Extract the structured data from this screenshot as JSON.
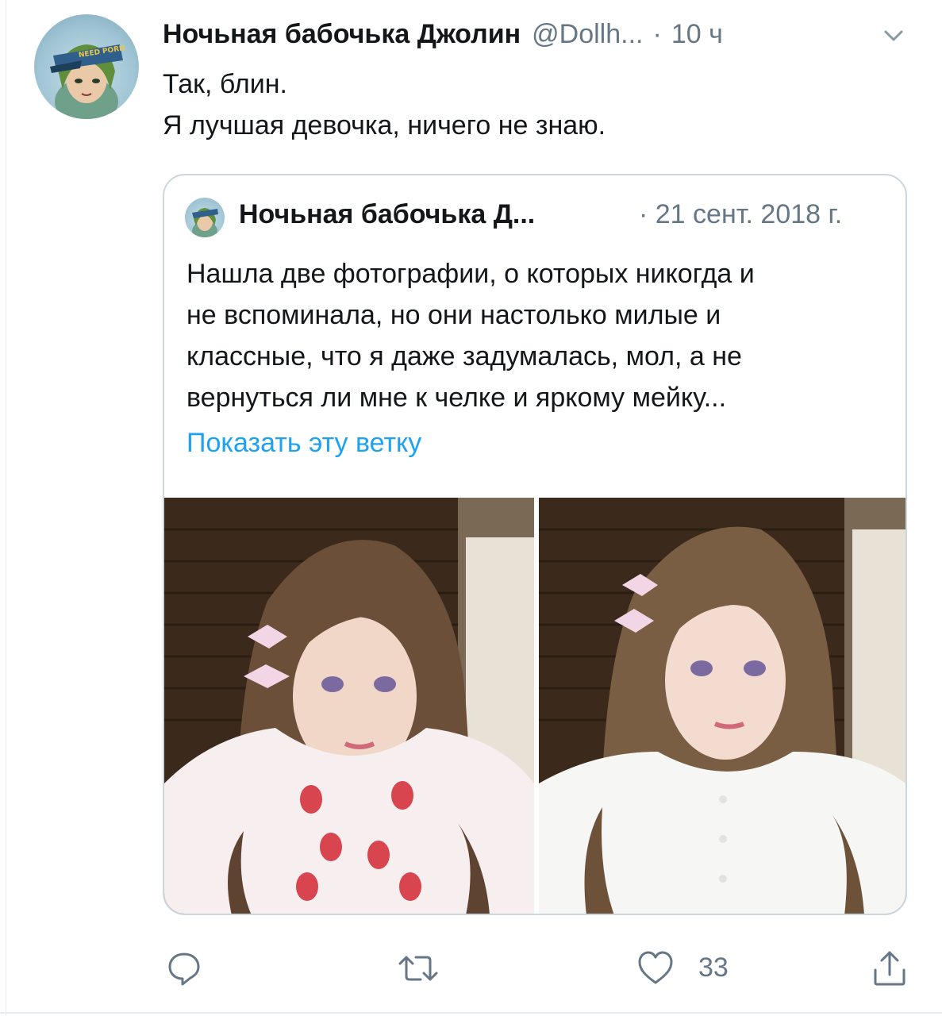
{
  "tweet": {
    "author_name": "Ночьная бабочька Джолин",
    "handle": "@Dollh...",
    "separator": "·",
    "time": "10 ч",
    "text_lines": [
      "Так, блин.",
      "Я лучшая девочка, ничего не знаю."
    ]
  },
  "quoted": {
    "author_name": "Ночьная бабочька Д...",
    "date": "· 21 сент. 2018 г.",
    "text_lines": [
      "Нашла две фотографии, о которых никогда и",
      "не вспоминала, но они настолько милые и",
      "классные, что я даже задумалась, мол, а не",
      "вернуться ли мне к челке и яркому мейку..."
    ],
    "show_thread": "Показать эту ветку"
  },
  "avatar_cap_text": "NEED PORN",
  "actions": {
    "like_count": "33",
    "icons": [
      "reply-icon",
      "retweet-icon",
      "like-icon",
      "share-icon"
    ]
  },
  "colors": {
    "link": "#1da1f2",
    "secondary_text": "#657786",
    "border": "#ccd6dd"
  }
}
